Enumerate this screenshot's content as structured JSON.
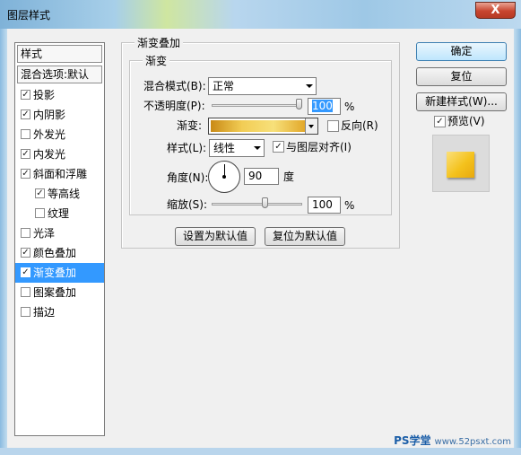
{
  "window": {
    "title": "图层样式",
    "close_label": "X"
  },
  "style_list": {
    "header": "样式",
    "blend_header": "混合选项:默认",
    "items": [
      {
        "label": "投影",
        "checked": true
      },
      {
        "label": "内阴影",
        "checked": true
      },
      {
        "label": "外发光",
        "checked": false
      },
      {
        "label": "内发光",
        "checked": true
      },
      {
        "label": "斜面和浮雕",
        "checked": true
      },
      {
        "label": "等高线",
        "checked": true
      },
      {
        "label": "纹理",
        "checked": false
      },
      {
        "label": "光泽",
        "checked": false
      },
      {
        "label": "颜色叠加",
        "checked": true
      },
      {
        "label": "渐变叠加",
        "checked": true,
        "selected": true
      },
      {
        "label": "图案叠加",
        "checked": false
      },
      {
        "label": "描边",
        "checked": false
      }
    ]
  },
  "panel": {
    "title": "渐变叠加",
    "inner_title": "渐变",
    "blend_mode_label": "混合模式(B):",
    "blend_mode_value": "正常",
    "opacity_label": "不透明度(P):",
    "opacity_value": "100",
    "percent": "%",
    "gradient_label": "渐变:",
    "gradient_colors": [
      "#c98a16",
      "#f2cd55",
      "#f7e07a",
      "#e2a82a"
    ],
    "reverse_label": "反向(R)",
    "reverse_checked": false,
    "style_label": "样式(L):",
    "style_value": "线性",
    "align_label": "与图层对齐(I)",
    "align_checked": true,
    "angle_label": "角度(N):",
    "angle_value": "90",
    "angle_unit": "度",
    "scale_label": "缩放(S):",
    "scale_value": "100",
    "opacity_slider_level": 1.0,
    "scale_slider_level": 0.6
  },
  "bottom_buttons": {
    "make_default": "设置为默认值",
    "reset_default": "复位为默认值"
  },
  "right_buttons": {
    "ok": "确定",
    "reset": "复位",
    "new_style": "新建样式(W)...",
    "preview_label": "预览(V)",
    "preview_checked": true
  },
  "preview": {
    "swatch_color": "#f4c21d"
  },
  "watermark": {
    "logo": "PS学堂",
    "url": "www.52psxt.com"
  }
}
